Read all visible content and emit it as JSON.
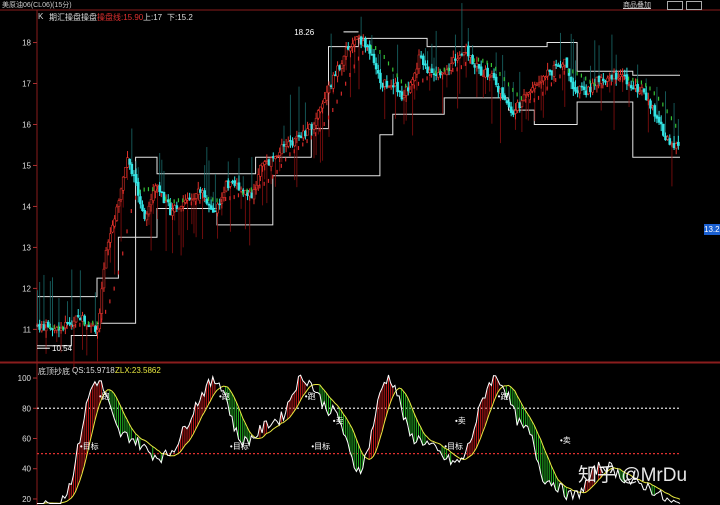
{
  "window": {
    "title": "美原油06(CL06)(15分)",
    "menu_add_label": "商品叠加",
    "menu_icons": [
      "grid-icon",
      "window-icon"
    ]
  },
  "main_panel": {
    "k_marker": "K",
    "indicator_name": "期汇操盘操盘",
    "field_label": "操盘线:15.90",
    "upper_label": "上:17",
    "lower_label": "下:15.2",
    "price_tag": "13.2",
    "high_label": "18.26",
    "low_label": "10.54"
  },
  "sub_panel": {
    "indicator_name": "底顶抄底",
    "qs_label": "QS:15.9718",
    "zlx_label": "ZLX:23.5862",
    "signal_top": "跑",
    "signal_sell": "卖",
    "signal_target": "目标"
  },
  "watermark": "知乎 @MrDu",
  "colors": {
    "up": "#e0312a",
    "down": "#33e5e5",
    "channel": "#e6e6e6",
    "ma_green": "#35c235",
    "ma_red": "#d82a2a",
    "line_white": "#ffffff",
    "line_yellow": "#e8e840",
    "dotted_white": "#dddddd",
    "dotted_red": "#e03030",
    "bg": "#000000"
  },
  "chart_data": [
    {
      "type": "candlestick",
      "title": "期汇操盘操盘",
      "y_ticks": [
        11,
        12,
        13,
        14,
        15,
        16,
        17,
        18
      ],
      "ylim": [
        10.35,
        18.55
      ],
      "grid": false,
      "annotations": [
        {
          "text": "18.26",
          "value": 18.26
        },
        {
          "text": "10.54",
          "value": 10.54
        }
      ],
      "close_path": [
        [
          0,
          11.1
        ],
        [
          10,
          11.0
        ],
        [
          20,
          11.3
        ],
        [
          28,
          11.0
        ],
        [
          32,
          12.9
        ],
        [
          38,
          14.2
        ],
        [
          42,
          15.2
        ],
        [
          46,
          14.6
        ],
        [
          50,
          13.6
        ],
        [
          55,
          14.6
        ],
        [
          62,
          13.9
        ],
        [
          70,
          14.2
        ],
        [
          76,
          14.4
        ],
        [
          82,
          13.8
        ],
        [
          88,
          14.5
        ],
        [
          94,
          14.5
        ],
        [
          100,
          14.2
        ],
        [
          104,
          14.9
        ],
        [
          110,
          15.2
        ],
        [
          116,
          15.5
        ],
        [
          122,
          15.7
        ],
        [
          126,
          15.8
        ],
        [
          132,
          16.4
        ],
        [
          138,
          17.1
        ],
        [
          144,
          17.8
        ],
        [
          150,
          18.1
        ],
        [
          154,
          17.9
        ],
        [
          160,
          17.0
        ],
        [
          166,
          17.0
        ],
        [
          170,
          16.7
        ],
        [
          174,
          17.0
        ],
        [
          178,
          17.6
        ],
        [
          184,
          17.2
        ],
        [
          190,
          17.2
        ],
        [
          196,
          17.7
        ],
        [
          200,
          17.8
        ],
        [
          206,
          17.3
        ],
        [
          212,
          17.2
        ],
        [
          218,
          16.6
        ],
        [
          222,
          16.3
        ],
        [
          228,
          16.7
        ],
        [
          234,
          17.1
        ],
        [
          240,
          17.3
        ],
        [
          246,
          17.6
        ],
        [
          250,
          16.9
        ],
        [
          256,
          16.8
        ],
        [
          262,
          17.1
        ],
        [
          268,
          17.2
        ],
        [
          274,
          17.1
        ],
        [
          282,
          16.8
        ],
        [
          288,
          16.3
        ],
        [
          292,
          15.8
        ],
        [
          296,
          15.5
        ],
        [
          300,
          15.6
        ]
      ],
      "channel_steps": [
        [
          0,
          10.6,
          11.8
        ],
        [
          16,
          10.85,
          11.8
        ],
        [
          28,
          11.15,
          12.25
        ],
        [
          38,
          11.15,
          13.25
        ],
        [
          46,
          13.25,
          15.2
        ],
        [
          56,
          13.95,
          14.8
        ],
        [
          74,
          13.95,
          14.8
        ],
        [
          84,
          13.55,
          14.8
        ],
        [
          102,
          13.55,
          15.2
        ],
        [
          110,
          14.75,
          15.2
        ],
        [
          128,
          14.75,
          15.9
        ],
        [
          136,
          14.75,
          17.9
        ],
        [
          150,
          14.75,
          18.1
        ],
        [
          160,
          15.75,
          18.1
        ],
        [
          166,
          16.25,
          18.1
        ],
        [
          182,
          16.25,
          17.9
        ],
        [
          190,
          16.65,
          17.9
        ],
        [
          220,
          16.35,
          17.9
        ],
        [
          232,
          16.0,
          17.9
        ],
        [
          238,
          16.0,
          18.0
        ],
        [
          248,
          16.0,
          18.0
        ],
        [
          252,
          16.55,
          17.3
        ],
        [
          272,
          16.55,
          17.3
        ],
        [
          278,
          15.2,
          17.2
        ],
        [
          300,
          15.2,
          17.2
        ]
      ]
    },
    {
      "type": "line",
      "title": "底顶抄底",
      "y_ticks": [
        20,
        40,
        60,
        80,
        100
      ],
      "ylim": [
        16,
        104
      ],
      "reference_lines": [
        80,
        50
      ],
      "series": [
        {
          "name": "QS",
          "last_value": 15.9718
        },
        {
          "name": "ZLX",
          "last_value": 23.5862
        }
      ],
      "annotations": [
        "跑",
        "卖",
        "目标"
      ]
    }
  ]
}
